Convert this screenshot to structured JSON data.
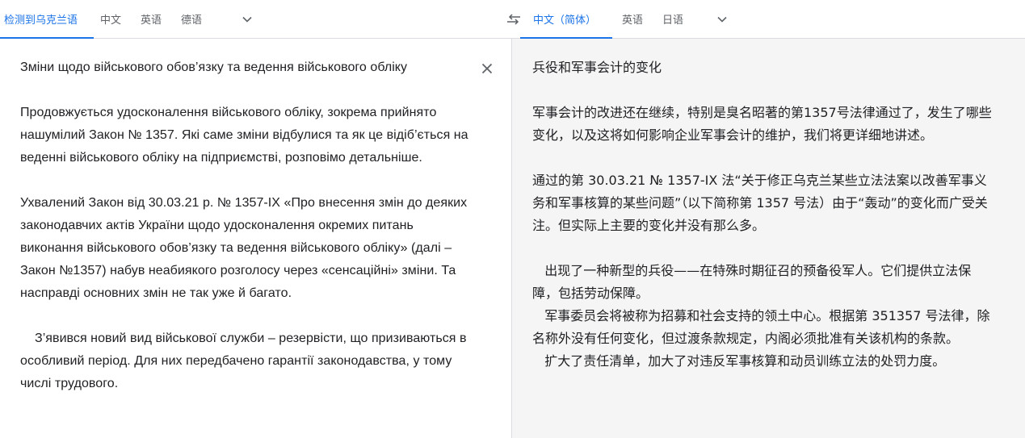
{
  "source_languages": {
    "tabs": [
      {
        "label": "检测到乌克兰语",
        "active": true
      },
      {
        "label": "中文",
        "active": false
      },
      {
        "label": "英语",
        "active": false
      },
      {
        "label": "德语",
        "active": false
      }
    ],
    "more_icon": "chevron-down-icon"
  },
  "swap_icon": "swap-arrows-icon",
  "target_languages": {
    "tabs": [
      {
        "label": "中文（简体）",
        "active": true
      },
      {
        "label": "英语",
        "active": false
      },
      {
        "label": "日语",
        "active": false
      }
    ],
    "more_icon": "chevron-down-icon"
  },
  "source": {
    "clear_icon": "close-icon",
    "paragraphs": [
      "Зміни щодо військового обов’язку та ведення військового обліку",
      "Продовжується удосконалення військового обліку, зокрема прийнято нашумілий Закон № 1357. Які саме зміни відбулися та як це відіб’ється на веденні військового обліку на підприємстві, розповімо детальніше.",
      "Ухвалений Закон від 30.03.21 р. № 1357-IX «Про внесення змін до деяких законодавчих актів України щодо удосконалення окремих питань виконання військового обов’язку та ведення військового обліку» (далі – Закон №1357) набув неабиякого розголосу через «сенсаційні» зміни. Та насправді основних змін не так уже й багато.",
      "    З’явився новий вид військової служби – резервісти, що призиваються в особливий період. Для них передбачено гарантії законодавства, у тому числі трудового."
    ]
  },
  "target": {
    "paragraphs": [
      "兵役和军事会计的变化",
      "军事会计的改进还在继续，特别是臭名昭著的第1357号法律通过了，发生了哪些变化，以及这将如何影响企业军事会计的维护，我们将更详细地讲述。",
      "通过的第 30.03.21 № 1357-IX 法“关于修正乌克兰某些立法法案以改善军事义务和军事核算的某些问题”（以下简称第 1357 号法）由于“轰动”的变化而广受关注。但实际上主要的变化并没有那么多。",
      "   出现了一种新型的兵役——在特殊时期征召的预备役军人。它们提供立法保障，包括劳动保障。",
      "   军事委员会将被称为招募和社会支持的领土中心。根据第 351357 号法律，除名称外没有任何变化，但过渡条款规定，内阁必须批准有关该机构的条款。",
      "   扩大了责任清单，加大了对违反军事核算和动员训练立法的处罚力度。"
    ]
  },
  "colors": {
    "accent": "#1a73e8",
    "inactive_tab": "#5f6368",
    "text": "#202124",
    "target_bg": "#f5f5f5",
    "border": "#dadce0"
  }
}
